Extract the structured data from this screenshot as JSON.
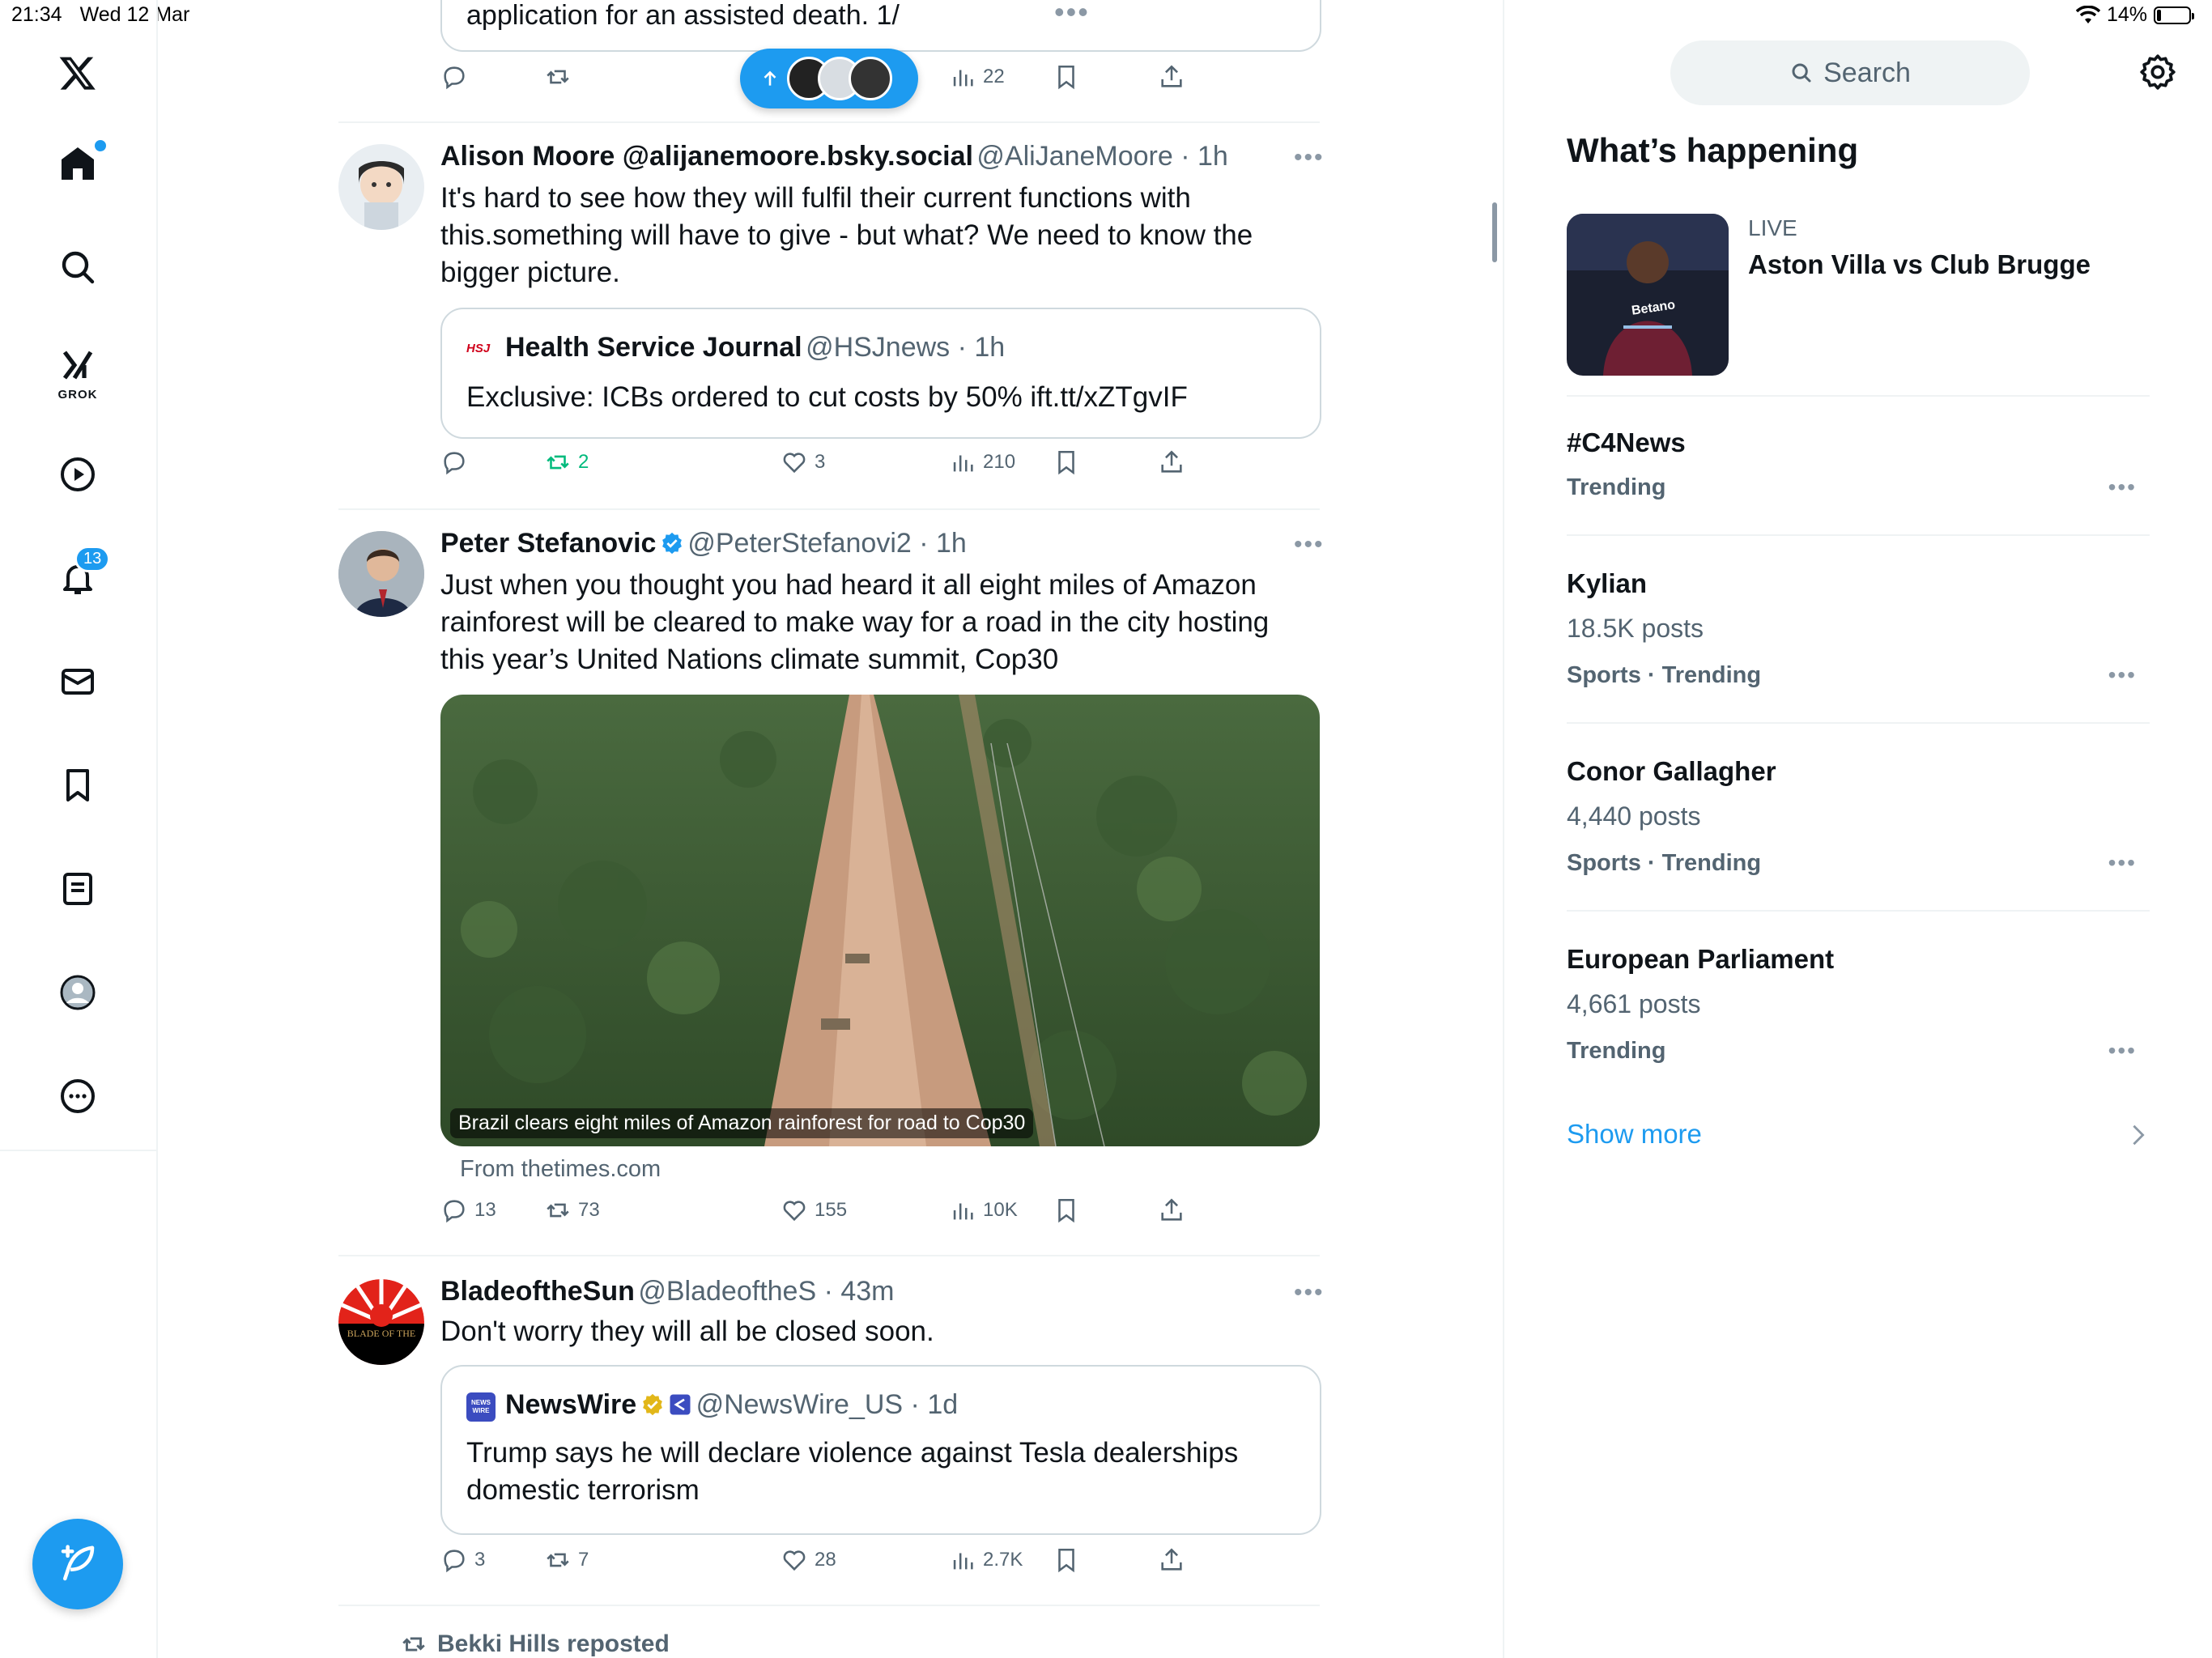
{
  "status_bar": {
    "time": "21:34",
    "date": "Wed 12 Mar",
    "battery": "14%",
    "battery_level": 0.14
  },
  "nav": {
    "grok_label": "GROK",
    "notifications_count": "13"
  },
  "new_posts_pill": {
    "icon": "arrow-up-icon"
  },
  "timeline": {
    "top_partial": {
      "text": "application for an assisted death. 1/",
      "views": "22"
    },
    "posts": [
      {
        "name": "Alison Moore @alijanemoore.bsky.social",
        "meta": "@AliJaneMoore · 1h",
        "text": "It's hard to see how they will fulfil their current functions with this.something will have to give - but what? We need to know the bigger picture.",
        "quote": {
          "logo": "HSJ",
          "name": "Health Service Journal",
          "meta": "@HSJnews · 1h",
          "text": "Exclusive: ICBs ordered to cut costs by 50% ift.tt/xZTgvIF"
        },
        "replies": "",
        "reposts": "2",
        "likes": "3",
        "views": "210"
      },
      {
        "name": "Peter Stefanovic",
        "meta": "@PeterStefanovi2 · 1h",
        "text": "Just when you thought you had heard it all eight miles of Amazon rainforest will be cleared to make way for a road in the city hosting this year’s United Nations climate summit, Cop30",
        "media_caption": "Brazil clears eight miles of Amazon rainforest for road to Cop30",
        "source": "From thetimes.com",
        "replies": "13",
        "reposts": "73",
        "likes": "155",
        "views": "10K"
      },
      {
        "name": "BladeoftheSun",
        "meta": "@BladeoftheS · 43m",
        "avatar_text": "BLADE OF THE",
        "text": "Don't worry they will all be closed soon.",
        "quote": {
          "logo": "NEWS WIRE",
          "name": "NewsWire",
          "meta": "@NewsWire_US · 1d",
          "text": "Trump says he will declare violence against Tesla dealerships domestic terrorism"
        },
        "replies": "3",
        "reposts": "7",
        "likes": "28",
        "views": "2.7K"
      }
    ],
    "repost_banner": "Bekki Hills reposted"
  },
  "sidebar": {
    "search_placeholder": "Search",
    "heading": "What’s happening",
    "live": {
      "label": "LIVE",
      "title": "Aston Villa vs Club Brugge",
      "shirt_text": "Betano"
    },
    "trends": [
      {
        "title": "#C4News",
        "posts": "",
        "meta": "Trending"
      },
      {
        "title": "Kylian",
        "posts": "18.5K posts",
        "meta": "Sports · Trending"
      },
      {
        "title": "Conor Gallagher",
        "posts": "4,440 posts",
        "meta": "Sports · Trending"
      },
      {
        "title": "European Parliament",
        "posts": "4,661 posts",
        "meta": "Trending"
      }
    ],
    "show_more": "Show more"
  },
  "colors": {
    "accent": "#1d9bf0",
    "repost_green": "#00ba7c",
    "text": "#0f1419",
    "muted": "#536471"
  }
}
